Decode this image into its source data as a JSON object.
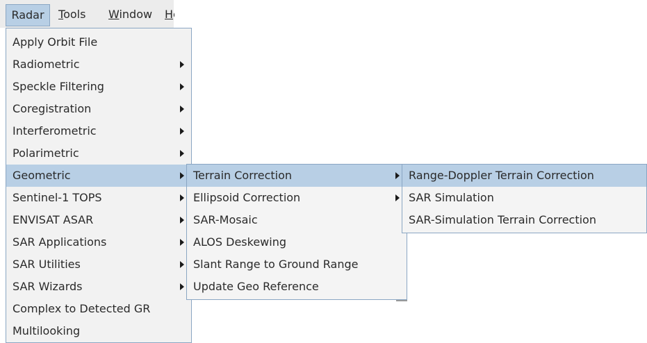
{
  "menubar": {
    "radar": "Radar",
    "tools_first": "T",
    "tools_rest": "ools",
    "window_first": "W",
    "window_rest": "indow",
    "help_first": "H",
    "help_rest": "e"
  },
  "radar_menu": {
    "items": [
      {
        "label": "Apply Orbit File",
        "submenu": false
      },
      {
        "label": "Radiometric",
        "submenu": true
      },
      {
        "label": "Speckle Filtering",
        "submenu": true
      },
      {
        "label": "Coregistration",
        "submenu": true
      },
      {
        "label": "Interferometric",
        "submenu": true
      },
      {
        "label": "Polarimetric",
        "submenu": true
      },
      {
        "label": "Geometric",
        "submenu": true,
        "active": true
      },
      {
        "label": "Sentinel-1 TOPS",
        "submenu": true
      },
      {
        "label": "ENVISAT ASAR",
        "submenu": true
      },
      {
        "label": "SAR Applications",
        "submenu": true
      },
      {
        "label": "SAR Utilities",
        "submenu": true
      },
      {
        "label": "SAR Wizards",
        "submenu": true
      },
      {
        "label": "Complex to Detected GR",
        "submenu": false
      },
      {
        "label": "Multilooking",
        "submenu": false
      }
    ]
  },
  "geometric_menu": {
    "items": [
      {
        "label": "Terrain Correction",
        "submenu": true,
        "active": true
      },
      {
        "label": "Ellipsoid Correction",
        "submenu": true
      },
      {
        "label": "SAR-Mosaic",
        "submenu": false
      },
      {
        "label": "ALOS Deskewing",
        "submenu": false
      },
      {
        "label": "Slant Range to Ground Range",
        "submenu": false
      },
      {
        "label": "Update Geo Reference",
        "submenu": false
      }
    ]
  },
  "terrain_menu": {
    "items": [
      {
        "label": "Range-Doppler Terrain Correction",
        "active": true
      },
      {
        "label": "SAR Simulation"
      },
      {
        "label": "SAR-Simulation Terrain Correction"
      }
    ]
  },
  "colors": {
    "highlight": "#b8cfe5",
    "border": "#8aa6c3",
    "menu_bg": "#f2f2f2"
  },
  "icons": {
    "submenu_arrow": "chevron-right-icon"
  }
}
